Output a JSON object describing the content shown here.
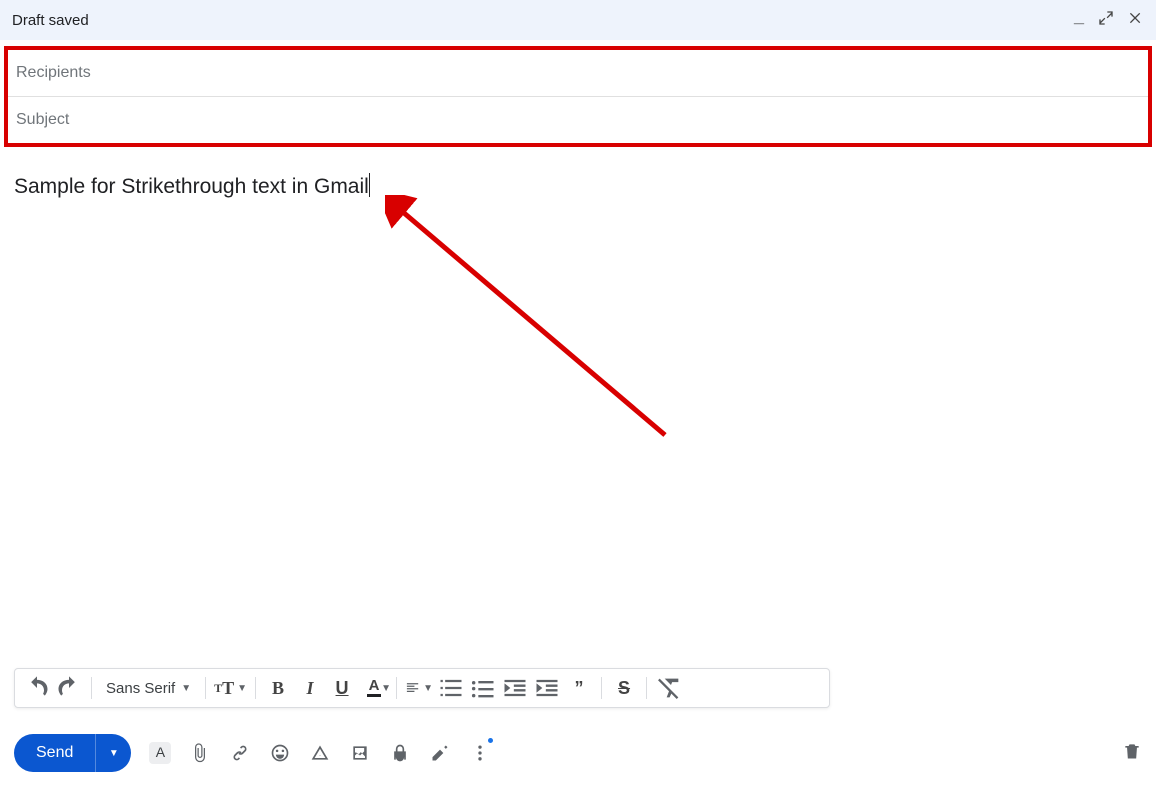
{
  "header": {
    "title": "Draft saved"
  },
  "fields": {
    "recipients_placeholder": "Recipients",
    "subject_placeholder": "Subject"
  },
  "body": {
    "text": "Sample for Strikethrough text in Gmail"
  },
  "toolbar": {
    "font": "Sans Serif"
  },
  "send": {
    "label": "Send"
  }
}
